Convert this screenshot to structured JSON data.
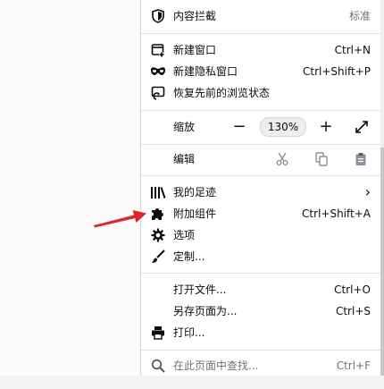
{
  "menu": {
    "content_blocking": {
      "label": "内容拦截",
      "value": "标准",
      "icon": "shield-icon"
    },
    "new_window": {
      "label": "新建窗口",
      "shortcut": "Ctrl+N",
      "icon": "new-window-icon"
    },
    "private_window": {
      "label": "新建隐私窗口",
      "shortcut": "Ctrl+Shift+P",
      "icon": "private-mask-icon"
    },
    "restore_session": {
      "label": "恢复先前的浏览状态",
      "icon": "restore-session-icon"
    },
    "zoom": {
      "label": "缩放",
      "minus": "−",
      "value": "130%",
      "plus": "+",
      "fullscreen_icon": "fullscreen-icon"
    },
    "edit": {
      "label": "编辑",
      "cut_icon": "scissors-icon",
      "copy_icon": "copy-icon",
      "paste_icon": "paste-icon"
    },
    "library": {
      "label": "我的足迹",
      "icon": "library-icon",
      "chevron": "›"
    },
    "addons": {
      "label": "附加组件",
      "shortcut": "Ctrl+Shift+A",
      "icon": "puzzle-icon"
    },
    "options": {
      "label": "选项",
      "icon": "gear-icon"
    },
    "customize": {
      "label": "定制...",
      "icon": "brush-icon"
    },
    "open_file": {
      "label": "打开文件...",
      "shortcut": "Ctrl+O"
    },
    "save_page": {
      "label": "另存页面为...",
      "shortcut": "Ctrl+S"
    },
    "print": {
      "label": "打印...",
      "icon": "printer-icon"
    },
    "find": {
      "label": "在此页面中查找...",
      "shortcut": "Ctrl+F",
      "icon": "search-icon"
    }
  },
  "annotation": {
    "arrow_color": "#e0262c"
  }
}
